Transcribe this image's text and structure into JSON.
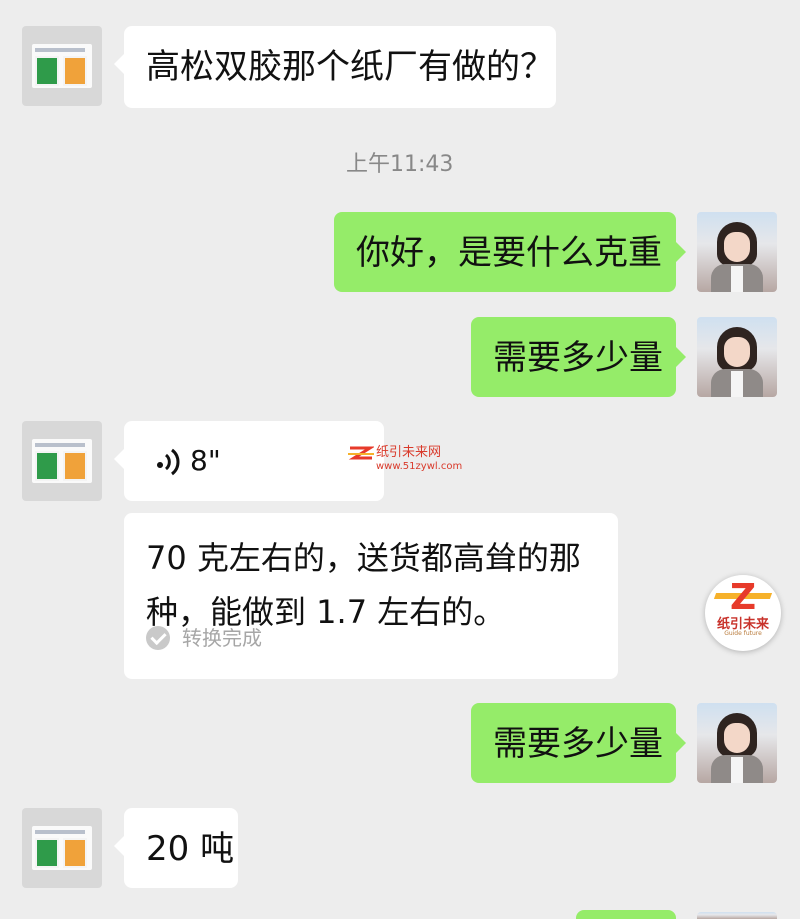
{
  "messages": {
    "m1_text": "高松双胶那个纸厂有做的？",
    "timestamp": "上午11:43",
    "m2_text": "你好，是要什么克重",
    "m3_text": "需要多少量",
    "voice_duration": "8\"",
    "transcript_text": "70 克左右的，送货都高耸的那种，能做到 1.7 左右的。",
    "transcript_status": "转换完成",
    "m5_text": "需要多少量",
    "m6_text": "20 吨"
  },
  "watermark": {
    "name": "纸引未来网",
    "url": "www.51zywl.com"
  },
  "floating_logo": {
    "letter": "Z",
    "name": "纸引未来",
    "subtitle": "Guide future"
  },
  "colors": {
    "background": "#ededed",
    "received_bubble": "#ffffff",
    "sent_bubble": "#95ec69",
    "logo_red": "#e73a2a"
  },
  "icons": {
    "voice": "voice-wave-icon",
    "check": "check-circle-icon"
  }
}
